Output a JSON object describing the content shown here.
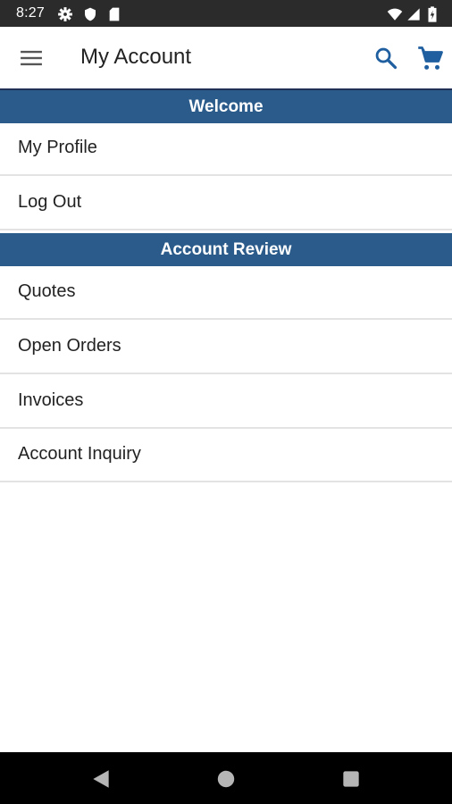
{
  "status_bar": {
    "time": "8:27",
    "icons": [
      "gear-icon",
      "shield-icon",
      "sd-card-icon",
      "wifi-icon",
      "signal-icon",
      "battery-icon"
    ]
  },
  "app_bar": {
    "title": "My Account",
    "icons": [
      "menu-icon",
      "search-icon",
      "cart-icon"
    ],
    "accent_color": "#2a5b8a"
  },
  "sections": [
    {
      "header": "Welcome",
      "items": [
        {
          "label": "My Profile"
        },
        {
          "label": "Log Out"
        }
      ]
    },
    {
      "header": "Account Review",
      "items": [
        {
          "label": "Quotes"
        },
        {
          "label": "Open Orders"
        },
        {
          "label": "Invoices"
        },
        {
          "label": "Account Inquiry"
        }
      ]
    }
  ],
  "nav_bar": {
    "icons": [
      "back-icon",
      "home-icon",
      "recents-icon"
    ]
  }
}
